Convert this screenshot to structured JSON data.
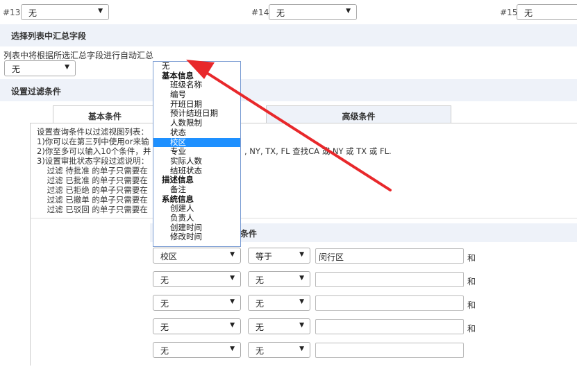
{
  "top_row": [
    {
      "num": "#13",
      "value": "无"
    },
    {
      "num": "#14",
      "value": "无"
    },
    {
      "num": "#15",
      "value": "无"
    }
  ],
  "summary_section": {
    "title": "选择列表中汇总字段",
    "desc": "列表中将根据所选汇总字段进行自动汇总",
    "select_value": "无"
  },
  "filter_section": {
    "title": "设置过滤条件",
    "tabs": [
      "基本条件",
      "高级条件"
    ],
    "info_lines": [
      "设置查询条件以过滤视图列表：",
      "1)你可以在第三列中使用or来输",
      "2)你至多可以输入10个条件，并",
      "3)设置审批状态字段过滤说明：",
      "    过滤 待批准 的单子只需要在",
      "    过滤 已批准 的单子只需要在",
      "    过滤 已拒绝 的单子只需要在",
      "    过滤 已撤单 的单子只需要在",
      "    过滤 已驳回 的单子只需要在"
    ],
    "info_extra": ", NY, TX, FL 查找CA 或 NY 或 TX 或 FL.",
    "subheader_tail": "条件",
    "conditions": [
      {
        "field": "校区",
        "op": "等于",
        "value": "闵行区",
        "join": "和"
      },
      {
        "field": "无",
        "op": "无",
        "value": "",
        "join": "和"
      },
      {
        "field": "无",
        "op": "无",
        "value": "",
        "join": "和"
      },
      {
        "field": "无",
        "op": "无",
        "value": "",
        "join": "和"
      },
      {
        "field": "无",
        "op": "无",
        "value": "",
        "join": ""
      }
    ]
  },
  "dropdown": {
    "options": [
      {
        "label": "无",
        "kind": "first"
      },
      {
        "label": "基本信息",
        "kind": "group"
      },
      {
        "label": "班级名称",
        "kind": "item"
      },
      {
        "label": "编号",
        "kind": "item"
      },
      {
        "label": "开班日期",
        "kind": "item"
      },
      {
        "label": "预计结班日期",
        "kind": "item"
      },
      {
        "label": "人数限制",
        "kind": "item"
      },
      {
        "label": "状态",
        "kind": "item"
      },
      {
        "label": "校区",
        "kind": "item",
        "selected": true
      },
      {
        "label": "专业",
        "kind": "item"
      },
      {
        "label": "实际人数",
        "kind": "item"
      },
      {
        "label": "结班状态",
        "kind": "item"
      },
      {
        "label": "描述信息",
        "kind": "group"
      },
      {
        "label": "备注",
        "kind": "item"
      },
      {
        "label": "系统信息",
        "kind": "group"
      },
      {
        "label": "创建人",
        "kind": "item"
      },
      {
        "label": "负责人",
        "kind": "item"
      },
      {
        "label": "创建时间",
        "kind": "item"
      },
      {
        "label": "修改时间",
        "kind": "item"
      }
    ]
  },
  "colors": {
    "band": "#eef2f9",
    "highlight": "#1e90ff",
    "arrow": "#e8282b"
  }
}
